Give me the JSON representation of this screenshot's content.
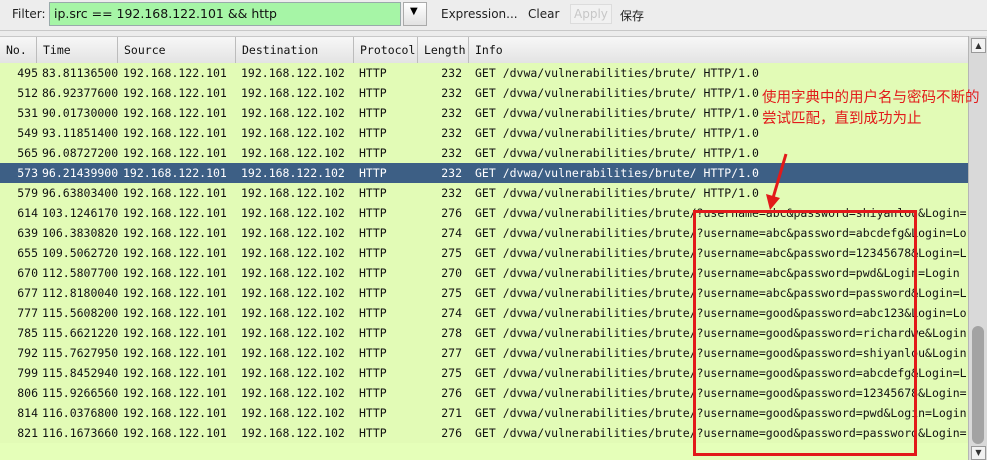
{
  "toolbar": {
    "filter_label": "Filter:",
    "filter_value": "ip.src == 192.168.122.101 && http",
    "expression": "Expression...",
    "clear": "Clear",
    "apply": "Apply",
    "save": "保存"
  },
  "columns": [
    "No.",
    "Time",
    "Source",
    "Destination",
    "Protocol",
    "Length",
    "Info"
  ],
  "packets": [
    {
      "no": "495",
      "time": "83.81136500",
      "src": "192.168.122.101",
      "dst": "192.168.122.102",
      "proto": "HTTP",
      "len": "232",
      "info": "GET /dvwa/vulnerabilities/brute/ HTTP/1.0"
    },
    {
      "no": "512",
      "time": "86.92377600",
      "src": "192.168.122.101",
      "dst": "192.168.122.102",
      "proto": "HTTP",
      "len": "232",
      "info": "GET /dvwa/vulnerabilities/brute/ HTTP/1.0"
    },
    {
      "no": "531",
      "time": "90.01730000",
      "src": "192.168.122.101",
      "dst": "192.168.122.102",
      "proto": "HTTP",
      "len": "232",
      "info": "GET /dvwa/vulnerabilities/brute/ HTTP/1.0"
    },
    {
      "no": "549",
      "time": "93.11851400",
      "src": "192.168.122.101",
      "dst": "192.168.122.102",
      "proto": "HTTP",
      "len": "232",
      "info": "GET /dvwa/vulnerabilities/brute/ HTTP/1.0"
    },
    {
      "no": "565",
      "time": "96.08727200",
      "src": "192.168.122.101",
      "dst": "192.168.122.102",
      "proto": "HTTP",
      "len": "232",
      "info": "GET /dvwa/vulnerabilities/brute/ HTTP/1.0"
    },
    {
      "no": "573",
      "time": "96.21439900",
      "src": "192.168.122.101",
      "dst": "192.168.122.102",
      "proto": "HTTP",
      "len": "232",
      "info": "GET /dvwa/vulnerabilities/brute/ HTTP/1.0"
    },
    {
      "no": "579",
      "time": "96.63803400",
      "src": "192.168.122.101",
      "dst": "192.168.122.102",
      "proto": "HTTP",
      "len": "232",
      "info": "GET /dvwa/vulnerabilities/brute/ HTTP/1.0"
    },
    {
      "no": "614",
      "time": "103.1246170",
      "src": "192.168.122.101",
      "dst": "192.168.122.102",
      "proto": "HTTP",
      "len": "276",
      "info": "GET /dvwa/vulnerabilities/brute/?username=abc&password=shiyanlou&Login=Lo"
    },
    {
      "no": "639",
      "time": "106.3830820",
      "src": "192.168.122.101",
      "dst": "192.168.122.102",
      "proto": "HTTP",
      "len": "274",
      "info": "GET /dvwa/vulnerabilities/brute/?username=abc&password=abcdefg&Login=Logi"
    },
    {
      "no": "655",
      "time": "109.5062720",
      "src": "192.168.122.101",
      "dst": "192.168.122.102",
      "proto": "HTTP",
      "len": "275",
      "info": "GET /dvwa/vulnerabilities/brute/?username=abc&password=12345678&Login=Log"
    },
    {
      "no": "670",
      "time": "112.5807700",
      "src": "192.168.122.101",
      "dst": "192.168.122.102",
      "proto": "HTTP",
      "len": "270",
      "info": "GET /dvwa/vulnerabilities/brute/?username=abc&password=pwd&Login=Login HT"
    },
    {
      "no": "677",
      "time": "112.8180040",
      "src": "192.168.122.101",
      "dst": "192.168.122.102",
      "proto": "HTTP",
      "len": "275",
      "info": "GET /dvwa/vulnerabilities/brute/?username=abc&password=password&Login=Log"
    },
    {
      "no": "777",
      "time": "115.5608200",
      "src": "192.168.122.101",
      "dst": "192.168.122.102",
      "proto": "HTTP",
      "len": "274",
      "info": "GET /dvwa/vulnerabilities/brute/?username=good&password=abc123&Login=Logi"
    },
    {
      "no": "785",
      "time": "115.6621220",
      "src": "192.168.122.101",
      "dst": "192.168.122.102",
      "proto": "HTTP",
      "len": "278",
      "info": "GET /dvwa/vulnerabilities/brute/?username=good&password=richardwe&Login="
    },
    {
      "no": "792",
      "time": "115.7627950",
      "src": "192.168.122.101",
      "dst": "192.168.122.102",
      "proto": "HTTP",
      "len": "277",
      "info": "GET /dvwa/vulnerabilities/brute/?username=good&password=shiyanlou&Login=L"
    },
    {
      "no": "799",
      "time": "115.8452940",
      "src": "192.168.122.101",
      "dst": "192.168.122.102",
      "proto": "HTTP",
      "len": "275",
      "info": "GET /dvwa/vulnerabilities/brute/?username=good&password=abcdefg&Login=Log"
    },
    {
      "no": "806",
      "time": "115.9266560",
      "src": "192.168.122.101",
      "dst": "192.168.122.102",
      "proto": "HTTP",
      "len": "276",
      "info": "GET /dvwa/vulnerabilities/brute/?username=good&password=12345678&Login=Lo"
    },
    {
      "no": "814",
      "time": "116.0376800",
      "src": "192.168.122.101",
      "dst": "192.168.122.102",
      "proto": "HTTP",
      "len": "271",
      "info": "GET /dvwa/vulnerabilities/brute/?username=good&password=pwd&Login=Login H"
    },
    {
      "no": "821",
      "time": "116.1673660",
      "src": "192.168.122.101",
      "dst": "192.168.122.102",
      "proto": "HTTP",
      "len": "276",
      "info": "GET /dvwa/vulnerabilities/brute/?username=good&password=password&Login=Lo"
    }
  ],
  "selected_no": "573",
  "annotation": {
    "text": "使用字典中的用户名与密码不断的尝试匹配，直到成功为止",
    "color": "#e21a1a"
  },
  "colors": {
    "row_bg": "#e2fbb6",
    "selected_bg": "#3d5f85",
    "filter_bg": "#a6f5a6"
  }
}
